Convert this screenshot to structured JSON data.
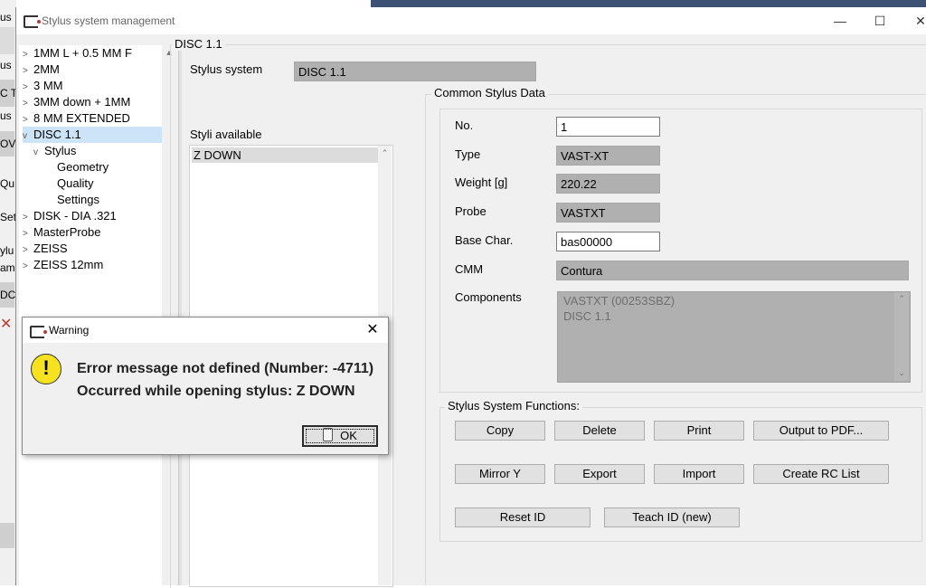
{
  "background_app": {
    "fragments": [
      "us",
      "us",
      "C T",
      "us",
      "OV",
      "Qu",
      "Set",
      "ylu",
      "am",
      "DC",
      "✕"
    ]
  },
  "window": {
    "title": "Stylus system management",
    "minimize": "—",
    "maximize": "☐",
    "close": "✕"
  },
  "tree": {
    "items": [
      {
        "label": "1MM L + 0.5 MM F",
        "level": 0,
        "arrow": ">"
      },
      {
        "label": "2MM",
        "level": 0,
        "arrow": ">"
      },
      {
        "label": "3 MM",
        "level": 0,
        "arrow": ">"
      },
      {
        "label": "3MM down + 1MM",
        "level": 0,
        "arrow": ">"
      },
      {
        "label": "8 MM EXTENDED",
        "level": 0,
        "arrow": ">"
      },
      {
        "label": "DISC 1.1",
        "level": 0,
        "arrow": "v"
      },
      {
        "label": "Stylus",
        "level": 1,
        "arrow": "v"
      },
      {
        "label": "Geometry",
        "level": 2,
        "arrow": ""
      },
      {
        "label": "Quality",
        "level": 2,
        "arrow": ""
      },
      {
        "label": "Settings",
        "level": 2,
        "arrow": ""
      },
      {
        "label": "DISK - DIA .321",
        "level": 0,
        "arrow": ">"
      },
      {
        "label": "MasterProbe",
        "level": 0,
        "arrow": ">"
      },
      {
        "label": "ZEISS",
        "level": 0,
        "arrow": ">"
      },
      {
        "label": "ZEISS 12mm",
        "level": 0,
        "arrow": ">"
      }
    ]
  },
  "panel": {
    "group_title": "DISC 1.1",
    "stylus_system_label": "Stylus system",
    "stylus_system_value": "DISC 1.1",
    "styli_available_label": "Styli available",
    "styli": [
      "Z DOWN"
    ]
  },
  "common": {
    "title": "Common Stylus Data",
    "no_label": "No.",
    "no_value": "1",
    "type_label": "Type",
    "type_value": "VAST-XT",
    "weight_label": "Weight [g]",
    "weight_value": "220.22",
    "probe_label": "Probe",
    "probe_value": "VASTXT",
    "basechar_label": "Base Char.",
    "basechar_value": "bas00000",
    "cmm_label": "CMM",
    "cmm_value": "Contura",
    "components_label": "Components",
    "components": [
      "VASTXT (00253SBZ)",
      "DISC 1.1"
    ]
  },
  "functions": {
    "title": "Stylus System Functions:",
    "copy": "Copy",
    "delete": "Delete",
    "print": "Print",
    "output_pdf": "Output to PDF...",
    "mirror_y": "Mirror Y",
    "export": "Export",
    "import": "Import",
    "create_rc": "Create RC List",
    "reset_id": "Reset ID",
    "teach_id": "Teach ID (new)"
  },
  "warning": {
    "title": "Warning",
    "close": "✕",
    "icon": "!",
    "line1": "Error message not defined (Number: -4711)",
    "line2": "Occurred while opening stylus: Z DOWN",
    "ok": "OK"
  },
  "icons": {
    "app": "zeiss-app-icon",
    "warning": "exclamation-warning-icon"
  }
}
